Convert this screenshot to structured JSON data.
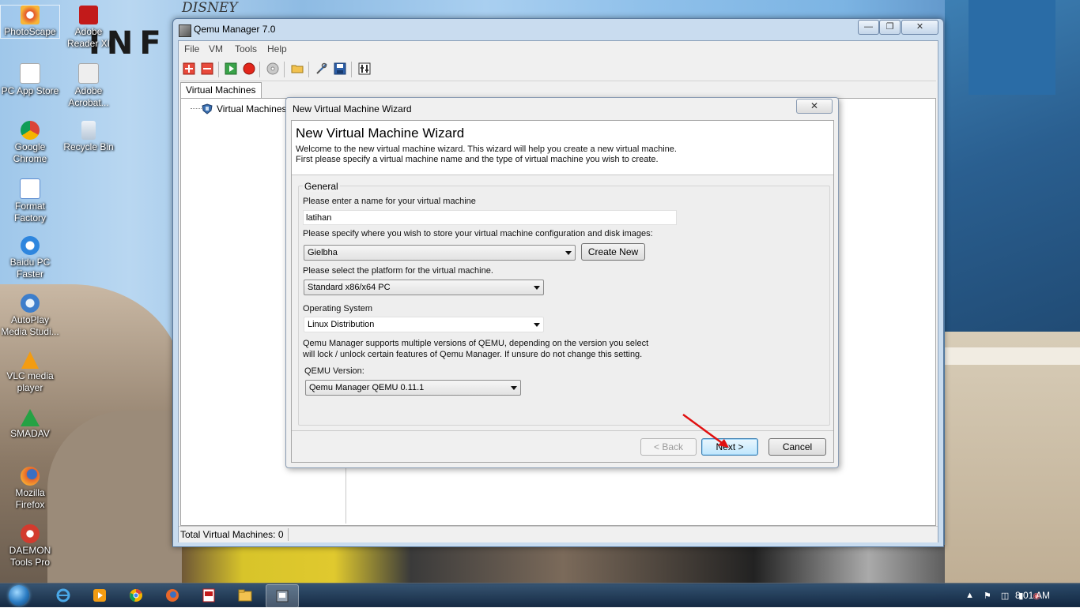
{
  "desktop": {
    "icons": [
      {
        "label": "PhotoScape",
        "color": "#e3562c"
      },
      {
        "label": "Adobe Reader XI",
        "color": "#c21a1a"
      },
      {
        "label": "PC App Store",
        "color": "#d9534f"
      },
      {
        "label": "Adobe Acrobat...",
        "color": "#c9c9c9"
      },
      {
        "label": "Google Chrome",
        "color": "#e0a21f"
      },
      {
        "label": "Recycle Bin",
        "color": "#d6e2ee"
      },
      {
        "label": "Format Factory",
        "color": "#5b8bd0"
      },
      {
        "label": "Baidu PC Faster",
        "color": "#2e86de"
      },
      {
        "label": "AutoPlay Media Studi...",
        "color": "#3d7ecb"
      },
      {
        "label": "VLC media player",
        "color": "#f39c12"
      },
      {
        "label": "SMADAV",
        "color": "#25a244"
      },
      {
        "label": "Mozilla Firefox",
        "color": "#e8672a"
      },
      {
        "label": "DAEMON Tools Pro",
        "color": "#d23b2e"
      }
    ],
    "wallpaper_text": {
      "brand": "DISNEY",
      "big": "INF"
    }
  },
  "window": {
    "title": "Qemu Manager 7.0",
    "menu": [
      "File",
      "VM",
      "Tools",
      "Help"
    ],
    "toolbar_icons": [
      "add-vm-icon",
      "remove-vm-icon",
      "start-vm-icon",
      "stop-vm-icon",
      "cd-icon",
      "open-folder-icon",
      "tools-icon",
      "save-icon",
      "settings-icon"
    ],
    "tab": "Virtual Machines",
    "tree_root": "Virtual Machines",
    "status": "Total Virtual Machines: 0"
  },
  "dialog": {
    "title": "New Virtual Machine Wizard",
    "heading": "New Virtual Machine Wizard",
    "intro_line1": "Welcome to the new virtual machine wizard.   This wizard will help you create a new virtual machine.",
    "intro_line2": "First please specify a virtual machine name and the type of virtual machine you wish to create.",
    "group_label": "General",
    "name_label": "Please enter a name for your virtual machine",
    "name_value": "latihan",
    "store_label": "Please specify where you wish to store your virtual machine configuration and disk images:",
    "store_value": "Gielbha",
    "create_new": "Create New",
    "platform_label": "Please select the platform for the virtual machine.",
    "platform_value": "Standard x86/x64 PC",
    "os_label": "Operating System",
    "os_value": "Linux Distribution",
    "qemu_note_line1": "Qemu Manager supports multiple versions of QEMU, depending on the version you select",
    "qemu_note_line2": "will lock / unlock certain features of Qemu Manager. If unsure do not change this setting.",
    "qemu_version_label": "QEMU Version:",
    "qemu_version_value": "Qemu Manager QEMU 0.11.1",
    "back": "< Back",
    "next": "Next >",
    "cancel": "Cancel",
    "close": "✕"
  },
  "taskbar": {
    "clock": "8:01 AM",
    "items": [
      "internet-explorer-icon",
      "media-player-icon",
      "chrome-icon",
      "firefox-icon",
      "photoscape-icon",
      "explorer-icon",
      "qemu-manager-icon"
    ]
  },
  "colors": {
    "annotation_arrow": "#e01010",
    "accent": "#3c7fb1"
  }
}
